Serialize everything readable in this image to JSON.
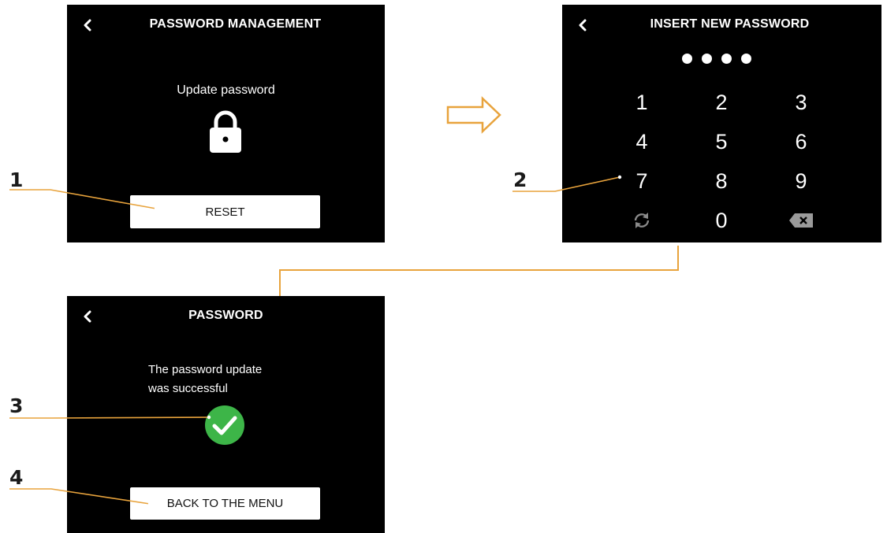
{
  "screen_password_management": {
    "title": "PASSWORD MANAGEMENT",
    "subtitle": "Update password",
    "reset_button": "RESET"
  },
  "screen_insert_password": {
    "title": "INSERT NEW PASSWORD",
    "entered_digits": 4,
    "keys": [
      "1",
      "2",
      "3",
      "4",
      "5",
      "6",
      "7",
      "8",
      "9",
      "0"
    ]
  },
  "screen_password_result": {
    "title": "PASSWORD",
    "message_line1": "The password update",
    "message_line2": "was successful",
    "back_button": "BACK TO THE MENU"
  },
  "callouts": [
    "1",
    "2",
    "3",
    "4"
  ],
  "colors": {
    "accent_orange": "#e8a33c",
    "success_green": "#3db548",
    "screen_bg": "#000000"
  }
}
